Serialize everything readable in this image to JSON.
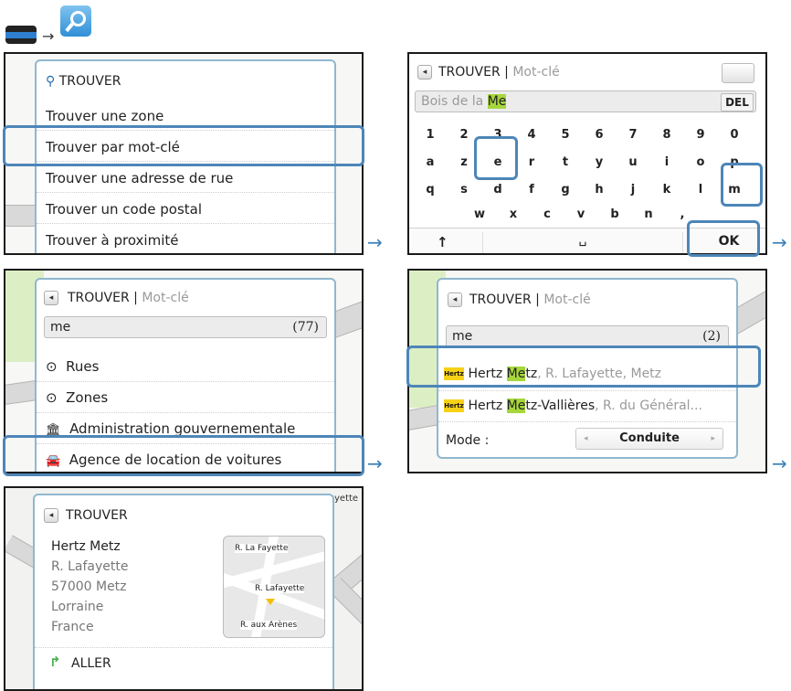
{
  "top_nav": {
    "arrow": "→",
    "menu_icon": "menu-bar-icon",
    "search_icon": "search-icon"
  },
  "shot1": {
    "header": "TROUVER",
    "items": [
      "Trouver une zone",
      "Trouver par mot-clé",
      "Trouver une adresse de rue",
      "Trouver un code postal",
      "Trouver à proximité"
    ]
  },
  "shot2": {
    "title": "TROUVER",
    "separator": "|",
    "subtitle": "Mot-clé",
    "input_prefix": "Bois de la ",
    "input_match": "Me",
    "del_label": "DEL",
    "row1": [
      "1",
      "2",
      "3",
      "4",
      "5",
      "6",
      "7",
      "8",
      "9",
      "0"
    ],
    "row2": [
      "a",
      "z",
      "e",
      "r",
      "t",
      "y",
      "u",
      "i",
      "o",
      "p"
    ],
    "row3": [
      "q",
      "s",
      "d",
      "f",
      "g",
      "h",
      "j",
      "k",
      "l",
      "m"
    ],
    "row4": [
      "w",
      "x",
      "c",
      "v",
      "b",
      "n",
      ","
    ],
    "shift_label": "↑",
    "space_label": "␣",
    "ok_label": "OK"
  },
  "shot3": {
    "title": "TROUVER",
    "separator": "|",
    "subtitle": "Mot-clé",
    "query": "me",
    "count": "(77)",
    "items": [
      {
        "icon": "⊙",
        "label": "Rues"
      },
      {
        "icon": "⊙",
        "label": "Zones"
      },
      {
        "icon": "🏛",
        "label": "Administration gouvernementale"
      },
      {
        "icon": "🚘",
        "label": "Agence de location de voitures"
      }
    ]
  },
  "shot4": {
    "title": "TROUVER",
    "separator": "|",
    "subtitle": "Mot-clé",
    "query": "me",
    "count": "(2)",
    "result1": {
      "logo": "Hertz",
      "pre": "Hertz ",
      "match": "Me",
      "post": "tz",
      "rest": ", R. Lafayette, Metz"
    },
    "result2": {
      "logo": "Hertz",
      "pre": "Hertz ",
      "match": "Me",
      "post": "tz-Vallières",
      "rest": ", R. du Général..."
    },
    "mode_label": "Mode :",
    "mode_value": "Conduite"
  },
  "shot5": {
    "title": "TROUVER",
    "name": "Hertz Metz",
    "address": [
      "R. Lafayette",
      "57000 Metz",
      "Lorraine",
      "France"
    ],
    "map_labels": [
      "R. La Fayette",
      "R. Lafayette",
      "R. aux Arènes"
    ],
    "edge_label": "yette",
    "go_label": "ALLER"
  },
  "colors": {
    "highlight": "#4d86b8",
    "match": "#a6d63c",
    "arrow": "#3a7fb8"
  }
}
